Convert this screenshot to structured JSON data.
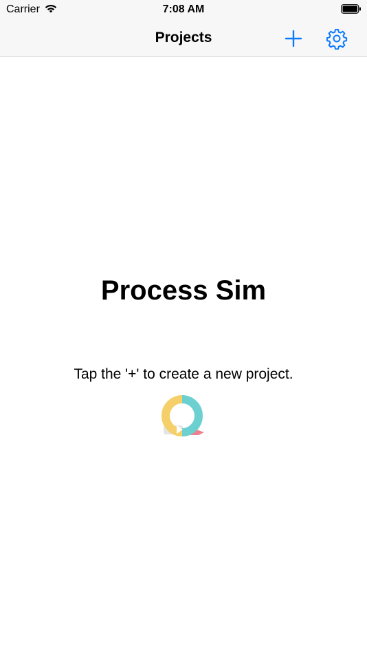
{
  "status_bar": {
    "carrier": "Carrier",
    "time": "7:08 AM",
    "icons": [
      "wifi-icon",
      "battery-icon"
    ]
  },
  "nav_bar": {
    "title": "Projects",
    "add_icon": "plus-icon",
    "settings_icon": "gear-icon"
  },
  "main": {
    "app_title": "Process Sim",
    "hint": "Tap the '+' to create a new project.",
    "logo_icon": "process-sim-logo"
  },
  "colors": {
    "tint": "#0a7aff",
    "bar_background": "#f7f7f7",
    "logo_yellow": "#f5d06a",
    "logo_teal": "#6dd0d0",
    "logo_pink": "#ef7f8e",
    "logo_gray": "#e4e4e4"
  }
}
